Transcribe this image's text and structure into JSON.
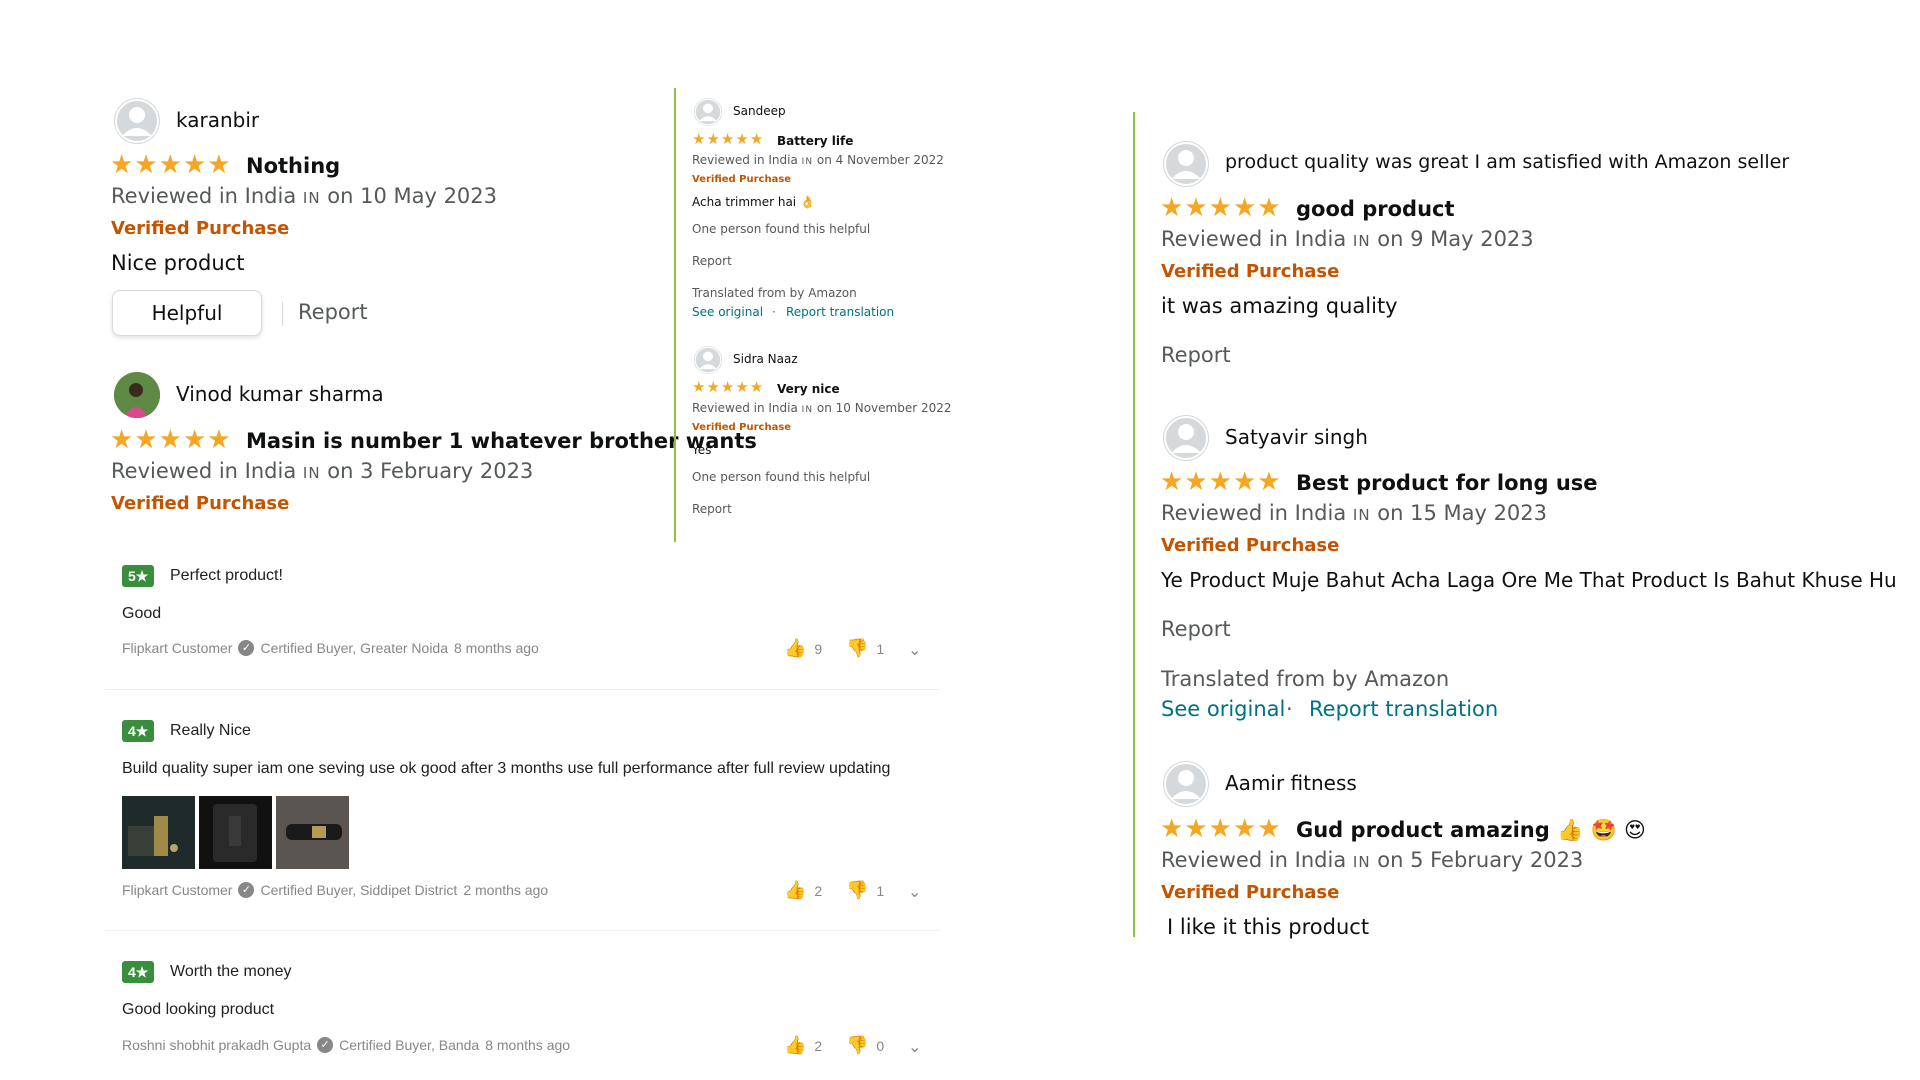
{
  "colors": {
    "star": "#f5a623",
    "verified": "#c45500",
    "link": "#007185",
    "flipkart_badge": "#388e3c",
    "divider": "#8bc34a"
  },
  "amazon_left": {
    "reviews": [
      {
        "name": "karanbir",
        "stars": 5,
        "title": "Nothing",
        "meta_pre": "Reviewed in India",
        "meta_code": "IN",
        "meta_post": "on 10 May 2023",
        "verified": "Verified Purchase",
        "body": "Nice product",
        "helpful": "Helpful",
        "report": "Report"
      },
      {
        "name": "Vinod kumar sharma",
        "stars": 5,
        "title": "Masin is number 1 whatever brother wants",
        "meta_pre": "Reviewed in India",
        "meta_code": "IN",
        "meta_post": "on 3 February 2023",
        "verified": "Verified Purchase"
      }
    ]
  },
  "amazon_mid": {
    "reviews": [
      {
        "name": "Sandeep",
        "stars": 5,
        "title": "Battery life",
        "meta_pre": "Reviewed in India",
        "meta_code": "IN",
        "meta_post": "on 4 November 2022",
        "verified": "Verified Purchase",
        "body": "Acha trimmer hai 👌",
        "helpful_count": "One person found this helpful",
        "report": "Report",
        "translated": "Translated from by Amazon",
        "see_original": "See original",
        "dot": "·",
        "report_translation": "Report translation"
      },
      {
        "name": "Sidra Naaz",
        "stars": 5,
        "title": "Very nice",
        "meta_pre": "Reviewed in India",
        "meta_code": "IN",
        "meta_post": "on 10 November 2022",
        "verified": "Verified Purchase",
        "body": "Yes",
        "helpful_count": "One person found this helpful",
        "report": "Report"
      }
    ]
  },
  "amazon_right": {
    "reviews": [
      {
        "name": "product quality was great I am satisfied with Amazon seller",
        "stars": 5,
        "title": "good product",
        "meta_pre": "Reviewed in India",
        "meta_code": "IN",
        "meta_post": "on 9 May 2023",
        "verified": "Verified Purchase",
        "body": "it was amazing quality",
        "report": "Report"
      },
      {
        "name": "Satyavir singh",
        "stars": 5,
        "title": "Best product for long use",
        "meta_pre": "Reviewed in India",
        "meta_code": "IN",
        "meta_post": "on 15 May 2023",
        "verified": "Verified Purchase",
        "body": "Ye Product Muje Bahut Acha Laga Ore Me That Product Is Bahut Khuse Hu",
        "report": "Report",
        "translated": "Translated from by Amazon",
        "see_original": "See original",
        "dot": "·",
        "report_translation": "Report translation"
      },
      {
        "name": "Aamir fitness",
        "stars": 5,
        "title": "Gud product amazing 👍 🤩 😍",
        "meta_pre": "Reviewed in India",
        "meta_code": "IN",
        "meta_post": "on 5 February 2023",
        "verified": "Verified Purchase",
        "body": "I like it this product"
      }
    ]
  },
  "flipkart": {
    "reviews": [
      {
        "rating": "5★",
        "title": "Perfect product!",
        "body": "Good",
        "author": "Flipkart Customer",
        "certified": "Certified Buyer, Greater Noida",
        "time": "8 months ago",
        "up": "9",
        "down": "1"
      },
      {
        "rating": "4★",
        "title": "Really Nice",
        "body": "Build quality super iam one seving use ok good after 3 months use full performance after full review updating",
        "author": "Flipkart Customer",
        "certified": "Certified Buyer, Siddipet District",
        "time": "2 months ago",
        "up": "2",
        "down": "1"
      },
      {
        "rating": "4★",
        "title": "Worth the money",
        "body": "Good looking product",
        "author": "Roshni shobhit prakadh Gupta",
        "certified": "Certified Buyer, Banda",
        "time": "8 months ago",
        "up": "2",
        "down": "0"
      }
    ]
  }
}
